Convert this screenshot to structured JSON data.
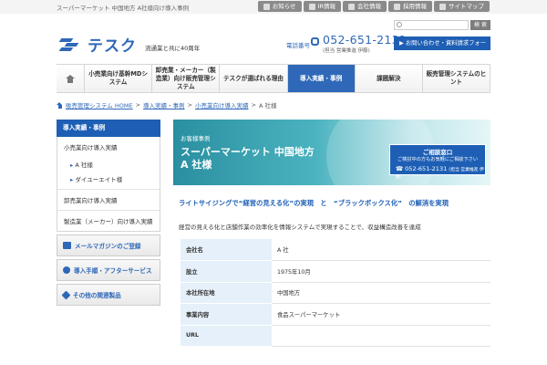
{
  "topbar": {
    "text": "スーパーマーケット 中国地方 A社様向け導入事例",
    "links": [
      {
        "label": "お知らせ",
        "icon": "bell-icon"
      },
      {
        "label": "IR情報",
        "icon": "chart-icon"
      },
      {
        "label": "会社情報",
        "icon": "building-icon"
      },
      {
        "label": "採用情報",
        "icon": "person-icon"
      },
      {
        "label": "サイトマップ",
        "icon": "sitemap-icon"
      }
    ]
  },
  "header": {
    "logo_text": "テスク",
    "tagline": "流通業と共に40周年",
    "search_button": "検 索",
    "tel_label": "電話番号",
    "tel_number": "052-651-2131",
    "tel_hours": "(担当 営業推進 伊藤)",
    "inquiry_button": "▶ お問い合わせ・資料請求フォーム"
  },
  "gnav": {
    "items": [
      {
        "label": "小売業向け基幹MDシステム",
        "active": false
      },
      {
        "label": "卸売業・メーカー（製造業）向け販売管理システム",
        "active": false
      },
      {
        "label": "テスクが選ばれる理由",
        "active": false
      },
      {
        "label": "導入実績・事例",
        "active": true
      },
      {
        "label": "課題解決",
        "active": false
      },
      {
        "label": "販売管理システムのヒント",
        "active": false
      }
    ]
  },
  "breadcrumb": {
    "items": [
      "販売管理システム HOME",
      "導入実績・事例",
      "小売業向け導入実績",
      "A 社様"
    ],
    "separator": ">"
  },
  "sidebar": {
    "heading": "導入実績・事例",
    "retail": "小売業向け導入実績",
    "subs": [
      "A 社様",
      "ダイユーエイト様"
    ],
    "wholesale": "卸売業向け導入実績",
    "manufacturer": "製造業（メーカー）向け導入実績",
    "banners": [
      {
        "label": "メールマガジンのご登録",
        "icon": "mail-icon"
      },
      {
        "label": "導入手順・アフターサービス",
        "icon": "people-icon"
      },
      {
        "label": "その他の関連製品",
        "icon": "tag-icon"
      }
    ]
  },
  "hero": {
    "label": "お客様事例",
    "title_line1": "スーパーマーケット 中国地方",
    "title_line2": "A 社様"
  },
  "consult": {
    "title": "ご相談窓口",
    "sub": "ご検討中の方もお気軽にご相談下さい",
    "tel": "052-651-2131",
    "tel_note": "(担当 営業推進 伊藤)"
  },
  "main": {
    "headline": "ライトサイジングで“経営の見える化”の実現　と　“ブラックボックス化”　の解消を実現",
    "description": "経営の見える化と店舗作業の効率化を情報システムで実現することで、収益構造改善を達成",
    "table": [
      {
        "key": "会社名",
        "value": "A 社"
      },
      {
        "key": "設立",
        "value": "1975年10月"
      },
      {
        "key": "本社所在地",
        "value": "中国地方"
      },
      {
        "key": "事業内容",
        "value": "食品スーパーマーケット"
      },
      {
        "key": "URL",
        "value": ""
      }
    ]
  },
  "colors": {
    "brand_blue": "#1e5fb5",
    "link_blue": "#2f68b8",
    "hero_teal": "#2a8fa0"
  }
}
